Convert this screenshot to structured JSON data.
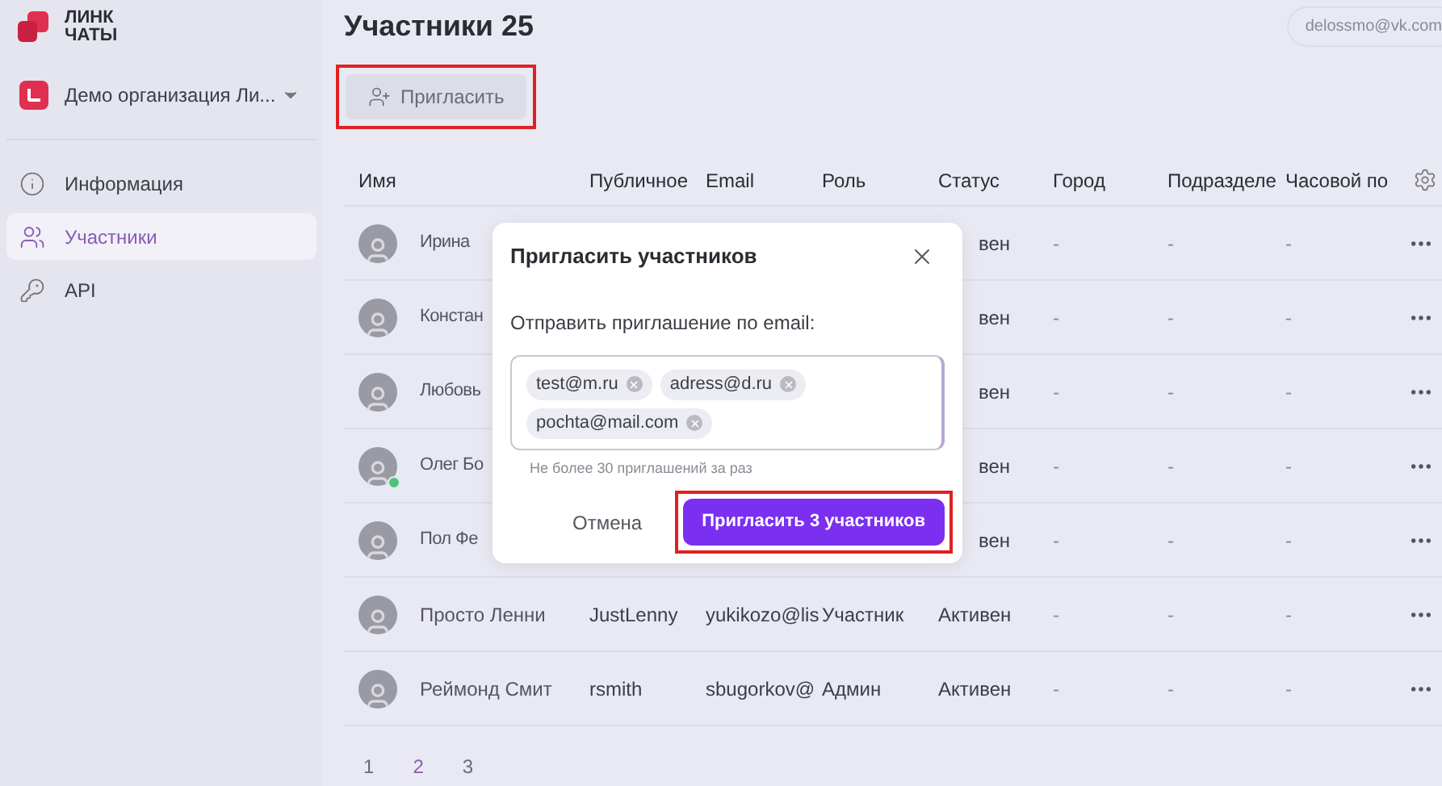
{
  "sidebar": {
    "logo": {
      "lines": [
        "ЛИНК",
        "ЧАТЫ"
      ]
    },
    "organization": {
      "name": "Демо организация Ли..."
    },
    "items": [
      {
        "label": "Информация",
        "selected": false
      },
      {
        "label": "Участники",
        "selected": true
      },
      {
        "label": "API",
        "selected": false
      }
    ]
  },
  "header": {
    "title": "Участники 25",
    "user": "delossmo@vk.com"
  },
  "invite_button": {
    "label": "Пригласить",
    "highlighted": true
  },
  "table": {
    "columns": [
      "Имя",
      "Публичное",
      "Email",
      "Роль",
      "Статус",
      "Город",
      "Подразделе",
      "Часовой по"
    ],
    "rows": [
      {
        "kind": "covered",
        "online": false,
        "cells": [
          "Ирина",
          "",
          "",
          "",
          "вен",
          "-",
          "-",
          "-"
        ]
      },
      {
        "kind": "covered",
        "online": false,
        "cells": [
          "Констан",
          "",
          "",
          "",
          "вен",
          "-",
          "-",
          "-"
        ]
      },
      {
        "kind": "covered",
        "online": false,
        "cells": [
          "Любовь",
          "",
          "",
          "",
          "вен",
          "-",
          "-",
          "-"
        ]
      },
      {
        "kind": "covered",
        "online": true,
        "cells": [
          "Олег Бо",
          "",
          "",
          "",
          "вен",
          "-",
          "-",
          "-"
        ]
      },
      {
        "kind": "covered",
        "online": false,
        "cells": [
          "Пол Фе",
          "",
          "",
          "",
          "вен",
          "-",
          "-",
          "-"
        ]
      },
      {
        "kind": "full",
        "online": false,
        "cells": [
          "Просто Ленни",
          "JustLenny",
          "yukikozo@lis",
          "Участник",
          "Активен",
          "-",
          "-",
          "-"
        ]
      },
      {
        "kind": "full",
        "online": false,
        "cells": [
          "Реймонд Смит",
          "rsmith",
          "sbugorkov@",
          "Админ",
          "Активен",
          "-",
          "-",
          "-"
        ]
      }
    ]
  },
  "pagination": [
    {
      "label": "1",
      "selected": false
    },
    {
      "label": "2",
      "selected": true
    },
    {
      "label": "3",
      "selected": false
    }
  ],
  "dialog": {
    "title": "Пригласить участников",
    "label": "Отправить приглашение по email:",
    "chips": [
      "test@m.ru",
      "adress@d.ru",
      "pochta@mail.com"
    ],
    "hint": "Не более 30 приглашений за раз",
    "cancel": "Отмена",
    "submit": {
      "label": "Пригласить 3 участников",
      "highlighted": true
    }
  }
}
